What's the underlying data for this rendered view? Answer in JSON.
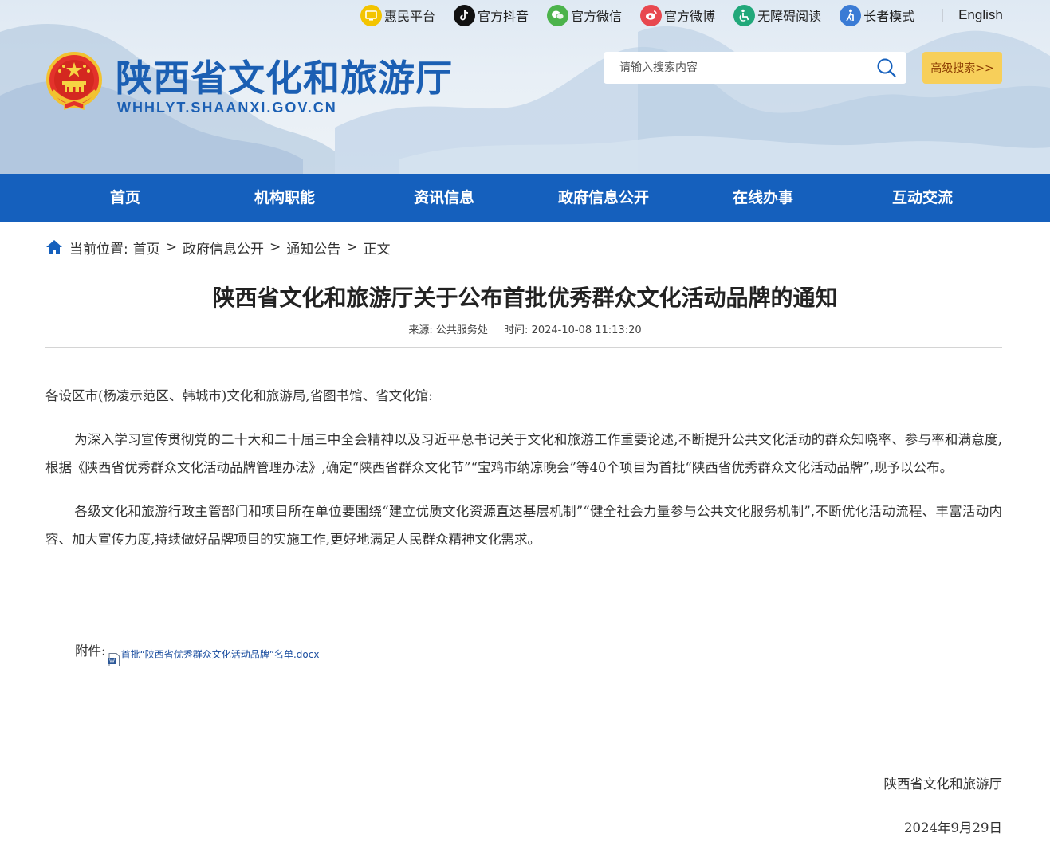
{
  "header": {
    "top_links": [
      {
        "label": "惠民平台",
        "icon": "tv-icon",
        "color": "#f3c400"
      },
      {
        "label": "官方抖音",
        "icon": "tiktok-icon",
        "color": "#111111"
      },
      {
        "label": "官方微信",
        "icon": "wechat-icon",
        "color": "#4bb34b"
      },
      {
        "label": "官方微博",
        "icon": "weibo-icon",
        "color": "#e8484f"
      },
      {
        "label": "无障碍阅读",
        "icon": "accessibility-icon",
        "color": "#21a87a"
      },
      {
        "label": "长者模式",
        "icon": "elder-icon",
        "color": "#3a7bd5"
      }
    ],
    "english_label": "English",
    "site_title": "陕西省文化和旅游厅",
    "site_domain": "WHHLYT.SHAANXI.GOV.CN",
    "search_placeholder": "请输入搜索内容",
    "advanced_search_label": "高级搜索>>"
  },
  "nav": {
    "items": [
      "首页",
      "机构职能",
      "资讯信息",
      "政府信息公开",
      "在线办事",
      "互动交流"
    ]
  },
  "breadcrumb": {
    "prefix": "当前位置:",
    "items": [
      "首页",
      "政府信息公开",
      "通知公告",
      "正文"
    ],
    "separator": ">"
  },
  "article": {
    "title": "陕西省文化和旅游厅关于公布首批优秀群众文化活动品牌的通知",
    "source": "来源:  公共服务处",
    "time": "时间:  2024-10-08 11:13:20",
    "salutation": "各设区市(杨凌示范区、韩城市)文化和旅游局,省图书馆、省文化馆:",
    "paragraphs": [
      "为深入学习宣传贯彻党的二十大和二十届三中全会精神以及习近平总书记关于文化和旅游工作重要论述,不断提升公共文化活动的群众知晓率、参与率和满意度,根据《陕西省优秀群众文化活动品牌管理办法》,确定“陕西省群众文化节”“宝鸡市纳凉晚会”等40个项目为首批“陕西省优秀群众文化活动品牌”,现予以公布。",
      "各级文化和旅游行政主管部门和项目所在单位要围绕“建立优质文化资源直达基层机制”“健全社会力量参与公共文化服务机制”,不断优化活动流程、丰富活动内容、加大宣传力度,持续做好品牌项目的实施工作,更好地满足人民群众精神文化需求。"
    ],
    "attachment_label": "附件:",
    "attachment_name": "首批“陕西省优秀群众文化活动品牌”名单.docx",
    "signature": "陕西省文化和旅游厅",
    "date": "2024年9月29日"
  },
  "colors": {
    "brand_blue": "#1560bd",
    "title_blue": "#1b5fb3",
    "advanced_search_bg": "#f7cf5a"
  }
}
